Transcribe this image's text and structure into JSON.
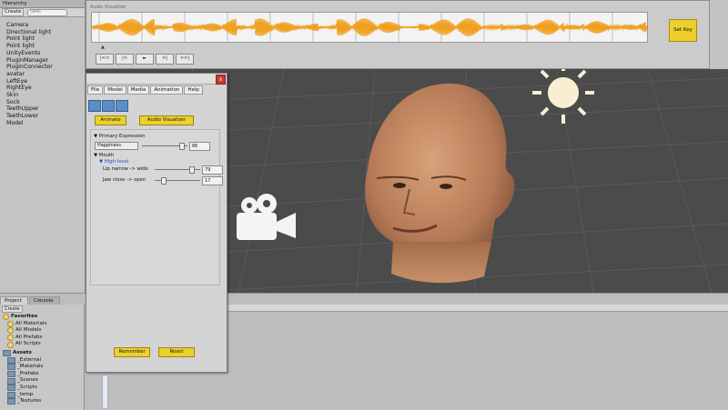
{
  "hierarchy": {
    "tab": "Hierarchy",
    "create": "Create",
    "search_placeholder": "Q▾All",
    "items": [
      "Camera",
      "Directional light",
      "Point light",
      "Point light",
      "UnityEvents",
      "PluginManager",
      "PluginConnector",
      "avatar",
      "LeftEye",
      "RightEye",
      "Skin",
      "Sock",
      "TeethUpper",
      "TeethLower",
      "Model"
    ]
  },
  "audio": {
    "title": "Audio Visualizer",
    "marker": "▲",
    "controls": [
      "|<<",
      "|<",
      "►",
      ">|",
      ">>|"
    ],
    "set_key": "Set Key",
    "wave_color": "#f0a020"
  },
  "project": {
    "tabs": [
      "Project",
      "Console"
    ],
    "create": "Create",
    "favorites_label": "Favorites",
    "favorites": [
      "All Materials",
      "All Models",
      "All Prefabs",
      "All Scripts"
    ],
    "assets_label": "Assets",
    "assets": [
      "_External",
      "_Materials",
      "_Prefabs",
      "_Scenes",
      "_Scripts",
      "_temp",
      "_Textures"
    ]
  },
  "panel": {
    "close": "x",
    "menu": [
      "File",
      "Model",
      "Media",
      "Animation",
      "Help"
    ],
    "animate": "Animate",
    "audio_visualizer": "Audio Visualizer",
    "primary_expression": "▼ Primary Expression",
    "expression_value": "Happiness",
    "expression_number": "86",
    "expression_level": 0.86,
    "mouth": "▼ Mouth",
    "high_level": "▼ High-level",
    "lip_label": "Lip narrow -> wide",
    "lip_number": "79",
    "lip_level": 0.79,
    "jaw_label": "Jaw close -> open",
    "jaw_number": "17",
    "jaw_level": 0.17,
    "remember": "Remember",
    "reset": "Reset"
  },
  "colors": {
    "button_yellow": "#ecd02d",
    "scene_bg": "#4a4a4a",
    "sun": "#f7efd0"
  }
}
